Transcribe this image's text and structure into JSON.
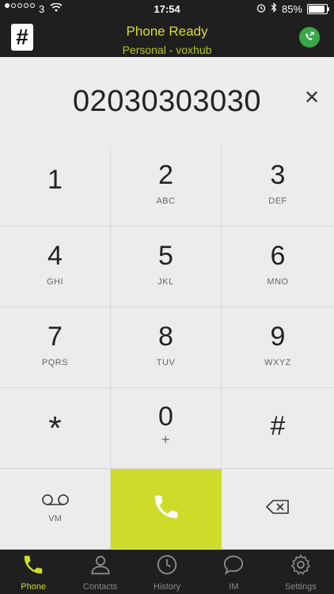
{
  "status_bar": {
    "carrier": "3",
    "time": "17:54",
    "battery_percent": "85%"
  },
  "header": {
    "title": "Phone Ready",
    "subtitle": "Personal - voxhub"
  },
  "display": {
    "number": "02030303030"
  },
  "keypad": {
    "keys": [
      {
        "digit": "1",
        "letters": ""
      },
      {
        "digit": "2",
        "letters": "ABC"
      },
      {
        "digit": "3",
        "letters": "DEF"
      },
      {
        "digit": "4",
        "letters": "GHI"
      },
      {
        "digit": "5",
        "letters": "JKL"
      },
      {
        "digit": "6",
        "letters": "MNO"
      },
      {
        "digit": "7",
        "letters": "PQRS"
      },
      {
        "digit": "8",
        "letters": "TUV"
      },
      {
        "digit": "9",
        "letters": "WXYZ"
      },
      {
        "digit": "*",
        "letters": ""
      },
      {
        "digit": "0",
        "letters": "+"
      },
      {
        "digit": "#",
        "letters": ""
      }
    ],
    "voicemail_label": "VM"
  },
  "tabs": [
    {
      "label": "Phone",
      "icon": "phone-icon",
      "active": true
    },
    {
      "label": "Contacts",
      "icon": "contacts-icon",
      "active": false
    },
    {
      "label": "History",
      "icon": "history-icon",
      "active": false
    },
    {
      "label": "IM",
      "icon": "chat-icon",
      "active": false
    },
    {
      "label": "Settings",
      "icon": "gear-icon",
      "active": false
    }
  ],
  "colors": {
    "accent": "#cddc2a",
    "header_bg": "#1f1f1f",
    "status_green": "#37a84a"
  }
}
